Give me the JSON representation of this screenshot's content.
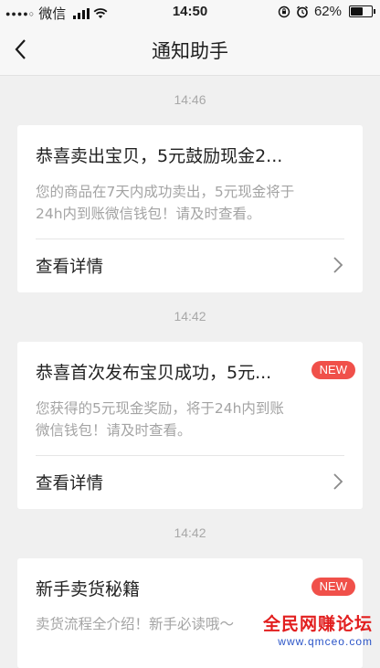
{
  "status_bar": {
    "carrier": "微信",
    "time": "14:50",
    "battery": "62%",
    "battery_level": 0.62
  },
  "nav": {
    "title": "通知助手"
  },
  "messages": [
    {
      "time": "14:46",
      "title": "恭喜卖出宝贝，5元鼓励现金2...",
      "body_line1": "您的商品在7天内成功卖出，5元现金将于",
      "body_line2": "24h内到账微信钱包！请及时查看。",
      "detail_label": "查看详情",
      "badge": ""
    },
    {
      "time": "14:42",
      "title": "恭喜首次发布宝贝成功，5元...",
      "body_line1": "您获得的5元现金奖励，将于24h内到账",
      "body_line2": "微信钱包！请及时查看。",
      "detail_label": "查看详情",
      "badge": "NEW"
    },
    {
      "time": "14:42",
      "title": "新手卖货秘籍",
      "body_line1": "卖货流程全介绍！新手必读哦～",
      "badge": "NEW"
    }
  ],
  "watermark": {
    "text": "全民网赚论坛",
    "url": "www.qmceo.com"
  }
}
